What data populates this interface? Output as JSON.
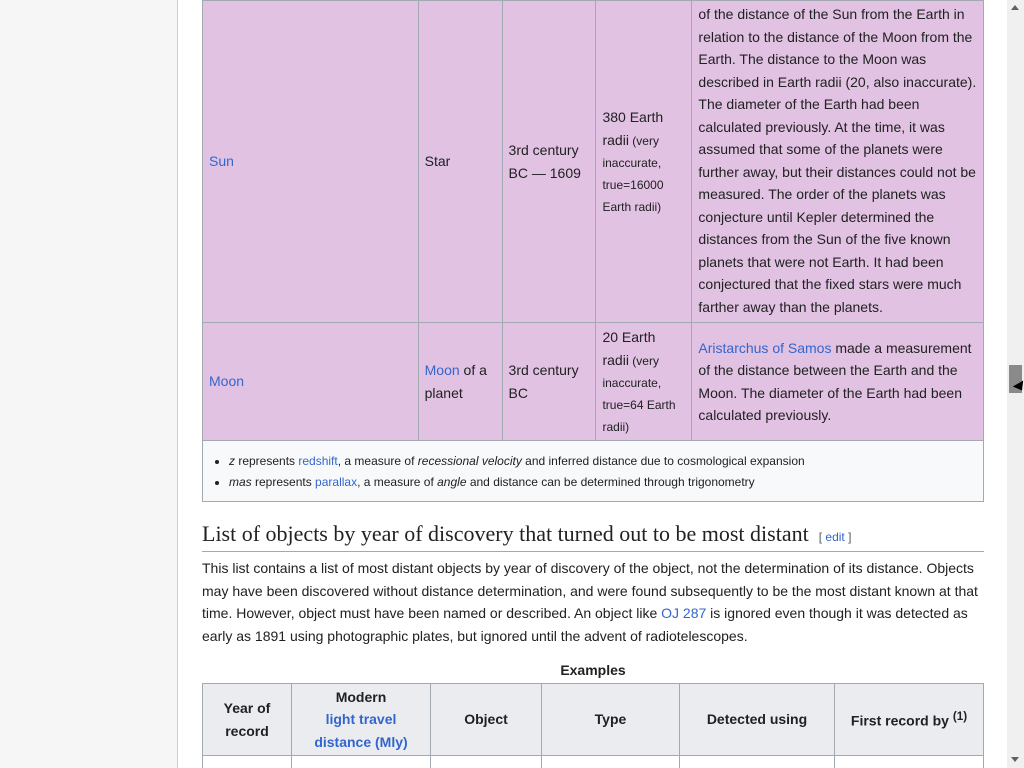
{
  "table": {
    "rows": [
      {
        "name": "Sun",
        "type": "Star",
        "period": "3rd century BC — 1609",
        "distance_main": "380 Earth radii",
        "distance_note": "(very inaccurate, true=16000 Earth radii)",
        "notes": "of the distance of the Sun from the Earth in relation to the distance of the Moon from the Earth. The distance to the Moon was described in Earth radii (20, also inaccurate). The diameter of the Earth had been calculated previously. At the time, it was assumed that some of the planets were further away, but their distances could not be measured. The order of the planets was conjecture until Kepler determined the distances from the Sun of the five known planets that were not Earth. It had been conjectured that the fixed stars were much farther away than the planets."
      },
      {
        "name": "Moon",
        "type_link": "Moon",
        "type_rest": " of a planet",
        "period": "3rd century BC",
        "distance_main": "20 Earth radii",
        "distance_note": "(very inaccurate, true=64 Earth radii)",
        "notes_link": "Aristarchus of Samos",
        "notes_rest": " made a measurement of the distance between the Earth and the Moon. The diameter of the Earth had been calculated previously."
      }
    ]
  },
  "footnotes": {
    "z": {
      "symbol": "z",
      "t1": " represents ",
      "link": "redshift",
      "t2": ", a measure of ",
      "em": "recessional velocity",
      "t3": " and inferred distance due to cosmological expansion"
    },
    "mas": {
      "symbol": "mas",
      "t1": " represents ",
      "link": "parallax",
      "t2": ", a measure of ",
      "em": "angle",
      "t3": " and distance can be determined through trigonometry"
    }
  },
  "section": {
    "heading": "List of objects by year of discovery that turned out to be most distant",
    "edit": "edit",
    "para1": "This list contains a list of most distant objects by year of discovery of the object, not the determination of its distance. Objects may have been discovered without distance determination, and were found subsequently to be the most distant known at that time. However, object must have been named or described. An object like ",
    "para_link": "OJ 287",
    "para2": " is ignored even though it was detected as early as 1891 using photographic plates, but ignored until the advent of radiotelescopes."
  },
  "examples": {
    "caption": "Examples",
    "headers": {
      "year": "Year of record",
      "modern": "Modern",
      "modern_link": "light travel distance (Mly)",
      "object": "Object",
      "type": "Type",
      "detected": "Detected using",
      "first": "First record by",
      "first_sup": "(1)"
    }
  }
}
